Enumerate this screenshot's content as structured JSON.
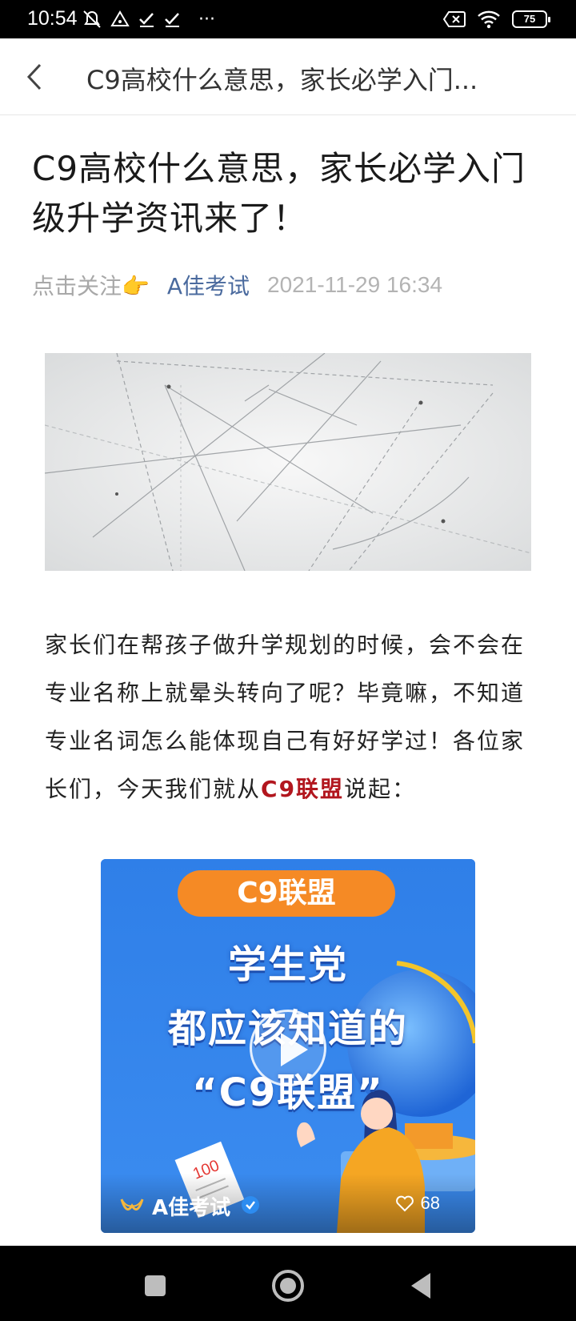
{
  "status_bar": {
    "time": "10:54",
    "more": "···",
    "battery": "75",
    "icons": [
      "mute-icon",
      "alert-icon",
      "check-icon",
      "check-icon",
      "close-box-icon",
      "wifi-icon",
      "battery-icon"
    ]
  },
  "header": {
    "back_icon": "chevron-left-icon",
    "title": "C9高校什么意思，家长必学入门..."
  },
  "article": {
    "title": "C9高校什么意思，家长必学入门级升学资讯来了！",
    "follow": "点击关注👉",
    "author": "A佳考试",
    "publish_time": "2021-11-29 16:34",
    "paragraph_before": "家长们在帮孩子做升学规划的时候，会不会在专业名称上就晕头转向了呢？毕竟嘛，不知道专业名词怎么能体现自己有好好学过！各位家长们，今天我们就从",
    "paragraph_highlight": "C9联盟",
    "paragraph_after": "说起："
  },
  "video": {
    "tag": "C9联盟",
    "line1": "学生党",
    "line2": "都应该知道的",
    "line3": "“C9联盟”",
    "channel": "A佳考试",
    "likes": "68",
    "play_icon": "play-icon"
  },
  "colors": {
    "highlight": "#b2161e",
    "author": "#4a6a9e",
    "video_blue": "#2f7fe8",
    "tag_orange": "#f58a25"
  }
}
